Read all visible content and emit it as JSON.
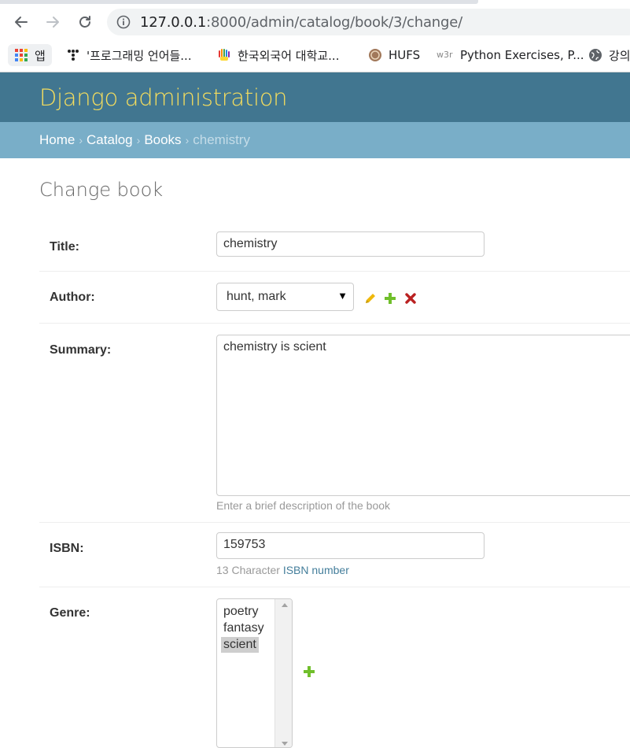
{
  "browser": {
    "url_host": "127.0.0.1",
    "url_rest": ":8000/admin/catalog/book/3/change/",
    "bookmarks": [
      {
        "label": "앱",
        "icon": "apps-grid-icon"
      },
      {
        "label": "'프로그래밍 언어들...",
        "icon": "dots-logo-icon"
      },
      {
        "label": "한국외국어 대학교...",
        "icon": "hands-logo-icon"
      },
      {
        "label": "HUFS",
        "icon": "hufs-logo-icon"
      },
      {
        "label": "Python Exercises, P...",
        "icon": "w3r-logo-icon",
        "icon_text": "w3r"
      },
      {
        "label": "강의",
        "icon": "globe-icon"
      }
    ]
  },
  "admin": {
    "branding": "Django administration",
    "breadcrumbs": {
      "home": "Home",
      "catalog": "Catalog",
      "books": "Books",
      "current": "chemistry",
      "separator": "›"
    },
    "page_title": "Change book",
    "fields": {
      "title": {
        "label": "Title:",
        "value": "chemistry"
      },
      "author": {
        "label": "Author:",
        "selected": "hunt, mark"
      },
      "summary": {
        "label": "Summary:",
        "value": "chemistry is scient",
        "help": "Enter a brief description of the book"
      },
      "isbn": {
        "label": "ISBN:",
        "value": "159753",
        "help_prefix": "13 Character ",
        "help_link": "ISBN number"
      },
      "genre": {
        "label": "Genre:",
        "options": [
          "poetry",
          "fantasy",
          "scient"
        ],
        "selected": "scient"
      }
    }
  },
  "colors": {
    "header_bg": "#417690",
    "branding_text": "#f5dd5d",
    "breadcrumbs_bg": "#79aec8",
    "change_link": "#efb80b",
    "add_link": "#70bf2b",
    "delete_link": "#ba2121"
  }
}
